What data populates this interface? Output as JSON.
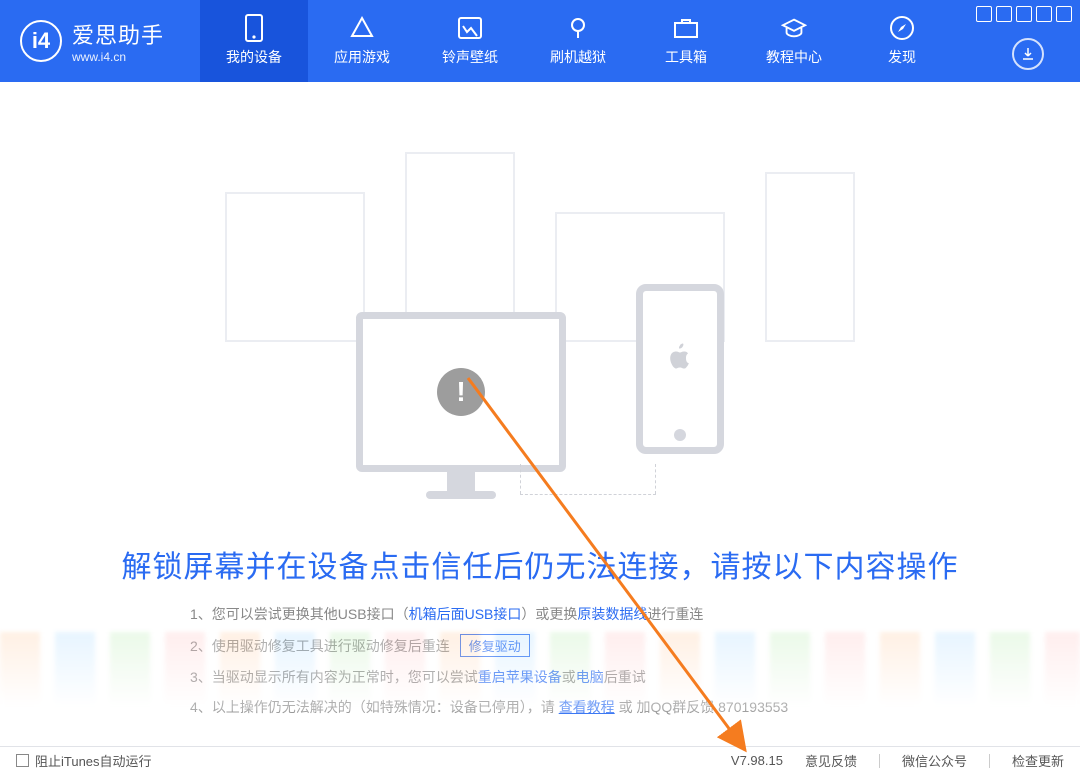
{
  "app": {
    "name": "爱思助手",
    "url": "www.i4.cn",
    "logo_letter": "i4"
  },
  "nav": {
    "items": [
      {
        "label": "我的设备"
      },
      {
        "label": "应用游戏"
      },
      {
        "label": "铃声壁纸"
      },
      {
        "label": "刷机越狱"
      },
      {
        "label": "工具箱"
      },
      {
        "label": "教程中心"
      },
      {
        "label": "发现"
      }
    ]
  },
  "main_message": "解锁屏幕并在设备点击信任后仍无法连接，请按以下内容操作",
  "instructions": {
    "row1": {
      "prefix": "1、您可以尝试更换其他USB接口（",
      "link1": "机箱后面USB接口",
      "mid": "）或更换",
      "link2": "原装数据线",
      "suffix": "进行重连"
    },
    "row2": {
      "text": "2、使用驱动修复工具进行驱动修复后重连",
      "button": "修复驱动"
    },
    "row3": {
      "prefix": "3、当驱动显示所有内容为正常时，您可以尝试",
      "link1": "重启苹果设备",
      "mid": "或",
      "link2": "电脑",
      "suffix": "后重试"
    },
    "row4": {
      "prefix": "4、以上操作仍无法解决的（如特殊情况：设备已停用），请 ",
      "link": "查看教程",
      "suffix": " 或 加QQ群反馈 870193553"
    }
  },
  "footer": {
    "checkbox_label": "阻止iTunes自动运行",
    "version": "V7.98.15",
    "feedback": "意见反馈",
    "wechat": "微信公众号",
    "check_update": "检查更新"
  }
}
